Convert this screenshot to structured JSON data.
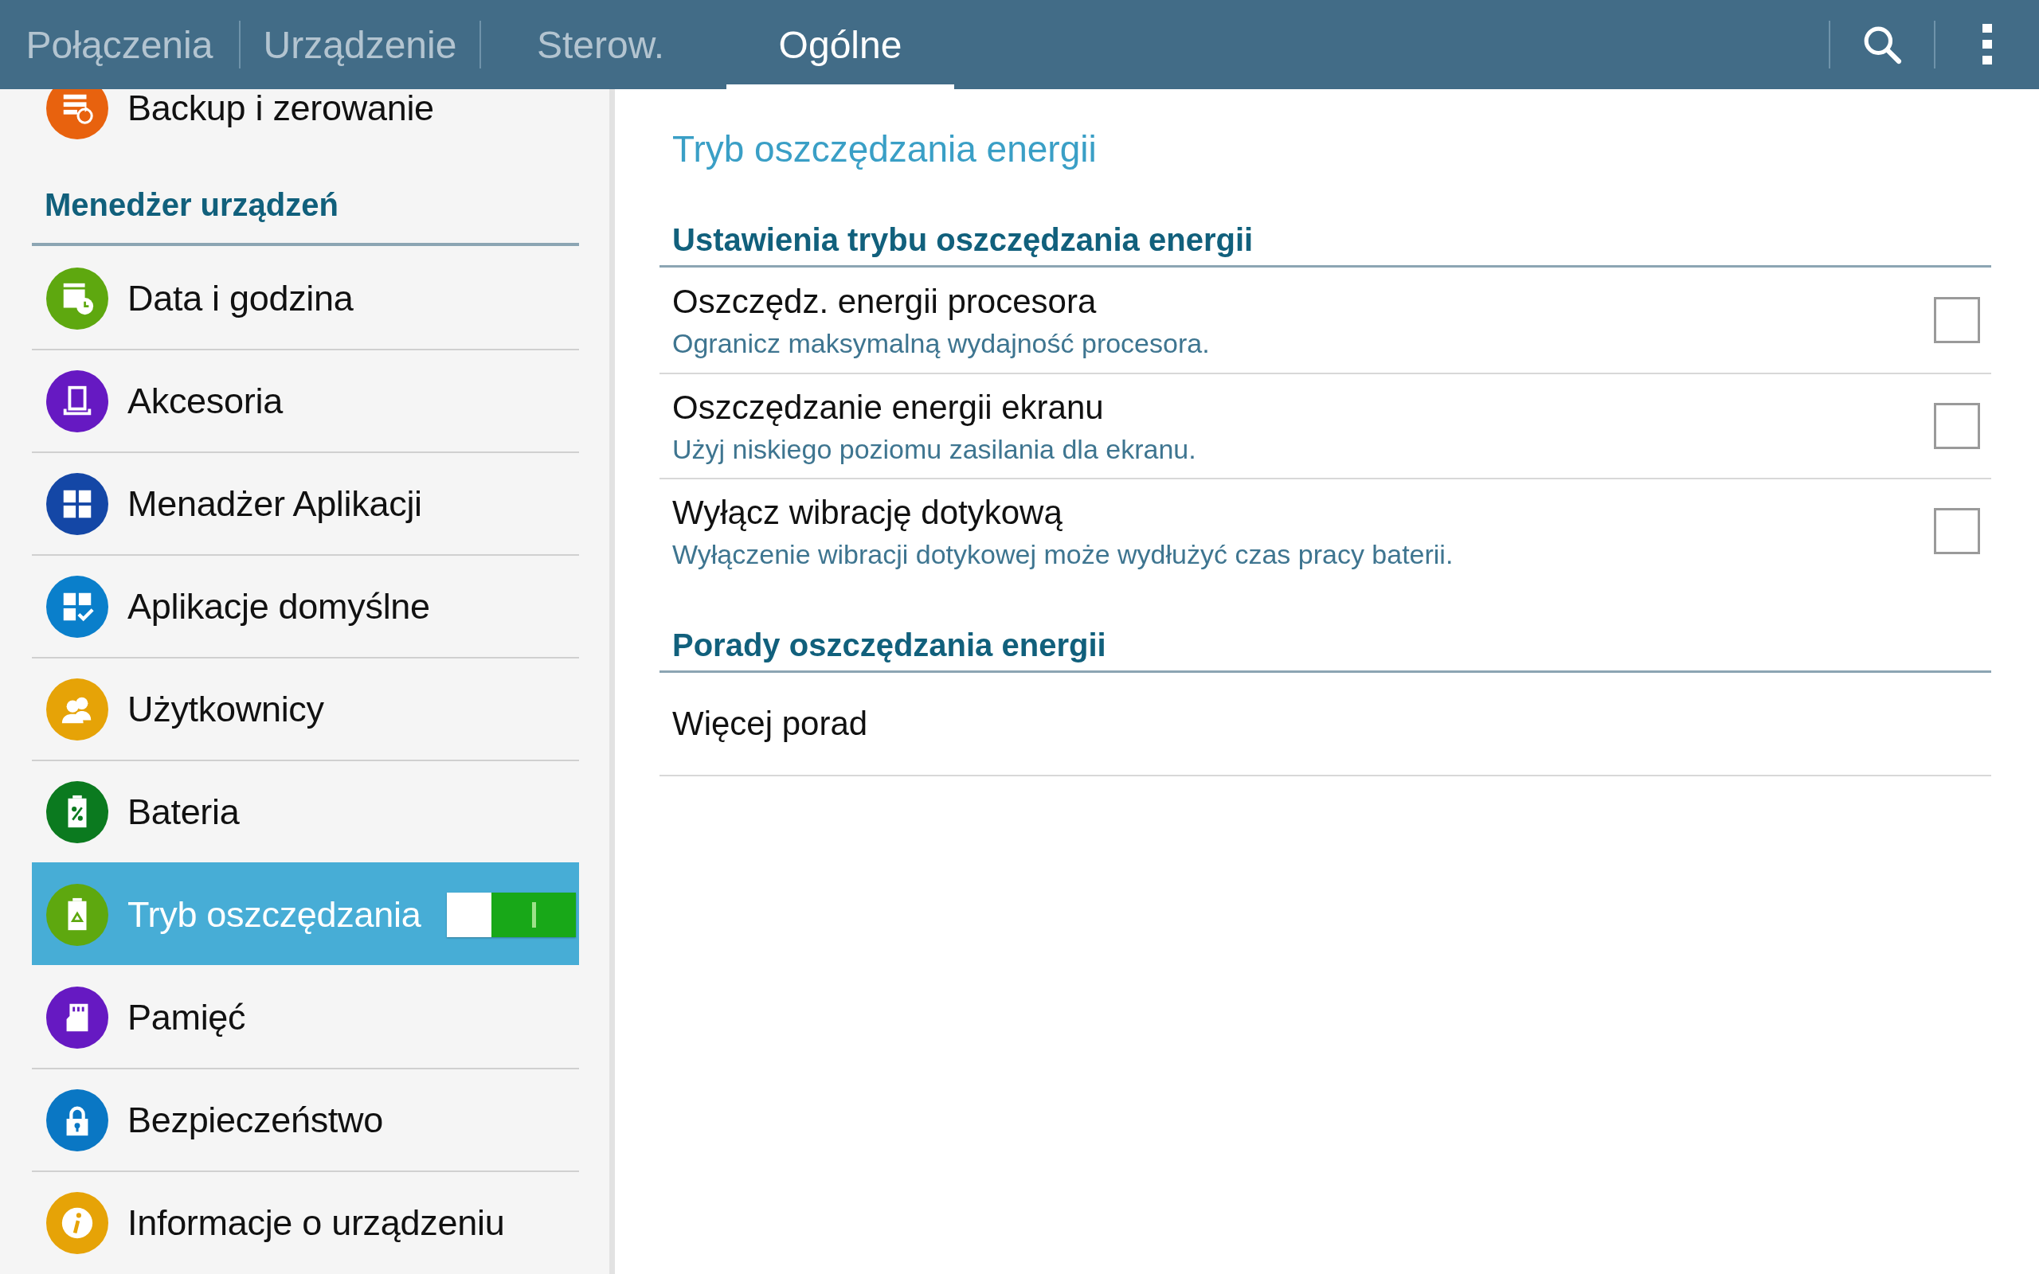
{
  "tabs": [
    {
      "label": "Połączenia",
      "selected": false
    },
    {
      "label": "Urządzenie",
      "selected": false
    },
    {
      "label": "Sterow.",
      "selected": false
    },
    {
      "label": "Ogólne",
      "selected": true
    }
  ],
  "sidebar": {
    "items": [
      {
        "kind": "item",
        "label": "Backup i zerowanie",
        "color": "#e8620e",
        "selected": false
      },
      {
        "kind": "header",
        "label": "Menedżer urządzeń"
      },
      {
        "kind": "item",
        "label": "Data i godzina",
        "color": "#5ea80f",
        "selected": false
      },
      {
        "kind": "item",
        "label": "Akcesoria",
        "color": "#6619c2",
        "selected": false
      },
      {
        "kind": "item",
        "label": "Menadżer Aplikacji",
        "color": "#1447a6",
        "selected": false
      },
      {
        "kind": "item",
        "label": "Aplikacje domyślne",
        "color": "#0a7fcb",
        "selected": false
      },
      {
        "kind": "item",
        "label": "Użytkownicy",
        "color": "#e6a307",
        "selected": false
      },
      {
        "kind": "item",
        "label": "Bateria",
        "color": "#0b7a1f",
        "selected": false
      },
      {
        "kind": "item",
        "label": "Tryb oszczędzania",
        "color": "#5ea80f",
        "selected": true,
        "toggle": {
          "on": true
        }
      },
      {
        "kind": "item",
        "label": "Pamięć",
        "color": "#6619c2",
        "selected": false
      },
      {
        "kind": "item",
        "label": "Bezpieczeństwo",
        "color": "#0a77c4",
        "selected": false
      },
      {
        "kind": "item",
        "label": "Informacje o urządzeniu",
        "color": "#e6a307",
        "selected": false
      }
    ]
  },
  "content": {
    "title": "Tryb oszczędzania energii",
    "sections": [
      {
        "header": "Ustawienia trybu oszczędzania energii",
        "rows": [
          {
            "kind": "checkbox",
            "title": "Oszczędz. energii procesora",
            "summary": "Ogranicz maksymalną wydajność procesora.",
            "checked": false
          },
          {
            "kind": "checkbox",
            "title": "Oszczędzanie energii ekranu",
            "summary": "Użyj niskiego poziomu zasilania dla ekranu.",
            "checked": false
          },
          {
            "kind": "checkbox",
            "title": "Wyłącz wibrację dotykową",
            "summary": "Wyłączenie wibracji dotykowej może wydłużyć czas pracy baterii.",
            "checked": false
          }
        ]
      },
      {
        "header": "Porady oszczędzania energii",
        "rows": [
          {
            "kind": "link",
            "title": "Więcej porad"
          }
        ]
      }
    ]
  }
}
